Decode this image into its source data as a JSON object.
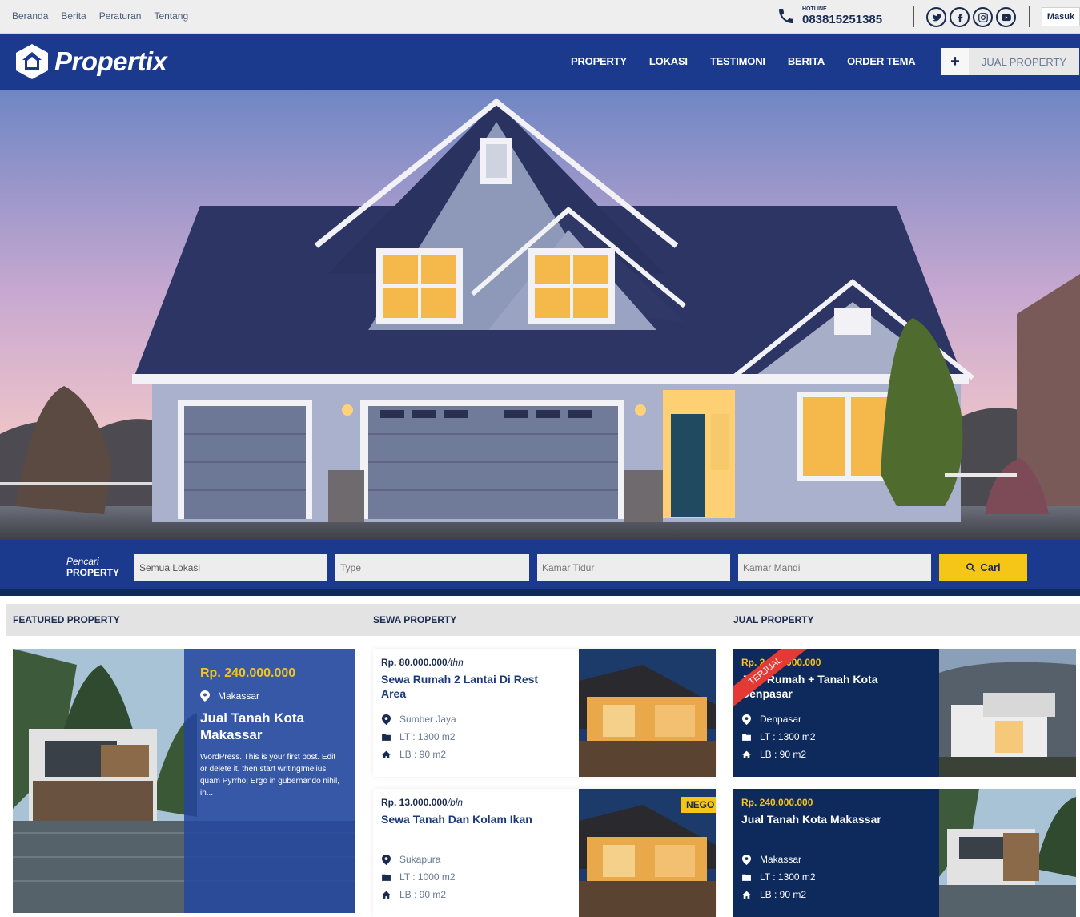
{
  "topbar": {
    "links": [
      "Beranda",
      "Berita",
      "Peraturan",
      "Tentang"
    ],
    "hotline_label": "HOTLINE",
    "hotline_number": "083815251385",
    "socials": [
      "twitter-icon",
      "facebook-icon",
      "instagram-icon",
      "youtube-icon"
    ],
    "login": "Masuk"
  },
  "nav": {
    "brand": "Propertix",
    "menu": [
      "PROPERTY",
      "LOKASI",
      "TESTIMONI",
      "BERITA",
      "ORDER TEMA"
    ],
    "cta_plus": "+",
    "cta_label": "JUAL PROPERTY"
  },
  "search": {
    "label_top": "Pencari",
    "label_bottom": "PROPERTY",
    "location": "Semua Lokasi",
    "type": "Type",
    "bedroom": "Kamar Tidur",
    "bathroom": "Kamar Mandi",
    "button": "Cari"
  },
  "sections": {
    "featured": "FEATURED PROPERTY",
    "rent": "SEWA PROPERTY",
    "sale": "JUAL PROPERTY"
  },
  "featured": {
    "price": "Rp. 240.000.000",
    "location": "Makassar",
    "title": "Jual Tanah Kota Makassar",
    "excerpt": "WordPress. This is your first post. Edit or delete it, then start writing!melius quam Pyrrho; Ergo in gubernando nihil, in..."
  },
  "rent": [
    {
      "price": "Rp. 80.000.000",
      "period": "/thn",
      "title": "Sewa Rumah 2 Lantai Di Rest Area",
      "location": "Sumber Jaya",
      "lt": "LT : 1300 m2",
      "lb": "LB : 90 m2"
    },
    {
      "price": "Rp. 13.000.000",
      "period": "/bln",
      "title": "Sewa Tanah Dan Kolam Ikan",
      "location": "Sukapura",
      "lt": "LT : 1000 m2",
      "lb": "LB : 90 m2",
      "badge": "NEGO"
    }
  ],
  "sale": [
    {
      "price": "Rp. 2.000.000.000",
      "title": "Jual Rumah + Tanah Kota Denpasar",
      "location": "Denpasar",
      "lt": "LT : 1300 m2",
      "lb": "LB : 90 m2",
      "ribbon": "TERJUAL"
    },
    {
      "price": "Rp. 240.000.000",
      "title": "Jual Tanah Kota Makassar",
      "location": "Makassar",
      "lt": "LT : 1300 m2",
      "lb": "LB : 90 m2"
    }
  ],
  "colors": {
    "navy": "#1b3a8e",
    "dark_navy": "#0e2a5c",
    "accent": "#f5c518",
    "ribbon": "#e53935"
  }
}
